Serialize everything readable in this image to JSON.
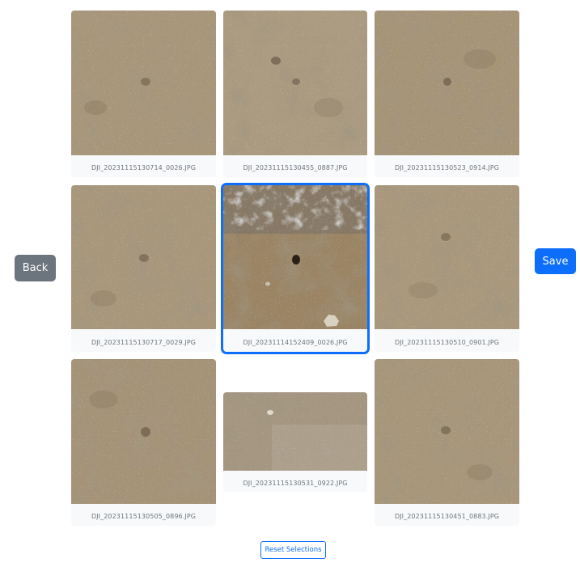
{
  "buttons": {
    "back_label": "Back",
    "save_label": "Save",
    "reset_label": "Reset Selections"
  },
  "colors": {
    "primary": "#0d6efd",
    "secondary": "#6c757d",
    "card_background": "#f8f9fa"
  },
  "images": [
    {
      "filename": "DJI_20231115130714_0026.JPG",
      "selected": false
    },
    {
      "filename": "DJI_20231115130455_0887.JPG",
      "selected": false
    },
    {
      "filename": "DJI_20231115130523_0914.JPG",
      "selected": false
    },
    {
      "filename": "DJI_20231115130717_0029.JPG",
      "selected": false
    },
    {
      "filename": "DJI_20231114152409_0026.JPG",
      "selected": true
    },
    {
      "filename": "DJI_20231115130510_0901.JPG",
      "selected": false
    },
    {
      "filename": "DJI_20231115130505_0896.JPG",
      "selected": false
    },
    {
      "filename": "DJI_20231115130531_0922.JPG",
      "selected": false
    },
    {
      "filename": "DJI_20231115130451_0883.JPG",
      "selected": false
    }
  ]
}
